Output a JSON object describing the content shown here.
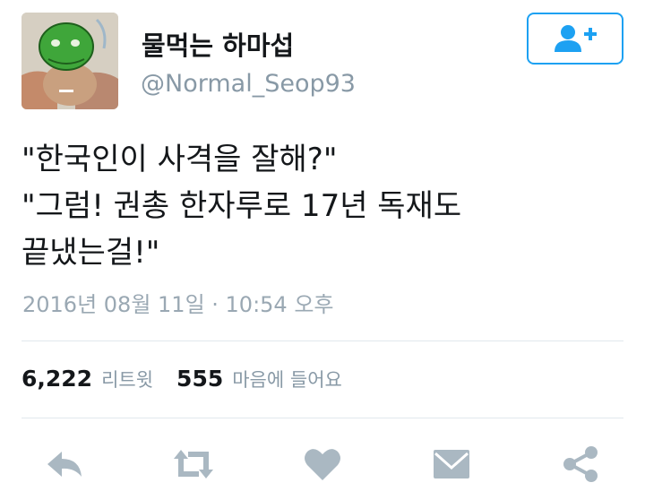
{
  "user": {
    "display_name": "물먹는 하마섭",
    "handle": "@Normal_Seop93",
    "avatar_icon": "frog-drawing-avatar"
  },
  "follow_button": {
    "icon": "add-user-icon"
  },
  "tweet": {
    "lines": [
      "\"한국인이 사격을 잘해?\"",
      "\"그럼! 권총 한자루로 17년 독재도",
      "끝냈는걸!\""
    ],
    "timestamp": "2016년 08월 11일 · 10:54 오후"
  },
  "stats": {
    "retweets_count": "6,222",
    "retweets_label": "리트윗",
    "likes_count": "555",
    "likes_label": "마음에 들어요"
  },
  "actions": [
    {
      "icon": "reply-icon"
    },
    {
      "icon": "retweet-icon"
    },
    {
      "icon": "heart-icon"
    },
    {
      "icon": "envelope-icon"
    },
    {
      "icon": "share-icon"
    }
  ],
  "colors": {
    "accent": "#1da1f2",
    "icon_gray": "#aab8c2",
    "secondary_text": "#8899a6"
  }
}
